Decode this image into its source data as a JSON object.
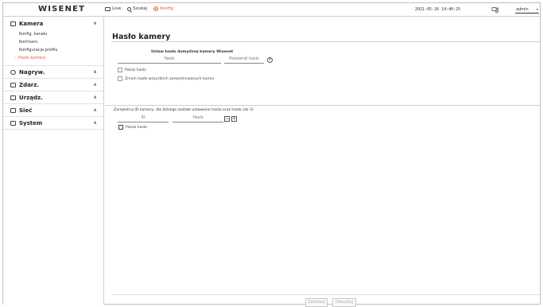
{
  "brand": {
    "logo": "WISENET"
  },
  "topnav": {
    "live": "Live",
    "search": "Szukaj",
    "config": "Konfig"
  },
  "status": {
    "datetime": "2021-05-26 14:40:25",
    "user": "admin"
  },
  "sidebar": {
    "groups": [
      {
        "label": "Kamera",
        "icon": "camera-icon",
        "expanded": true,
        "items": [
          {
            "label": "Konfig. kanału"
          },
          {
            "label": "Konf.kam."
          },
          {
            "label": "Konfiguracja profilu"
          },
          {
            "label": "Hasło kamery",
            "active": true
          }
        ]
      },
      {
        "label": "Nagryw.",
        "icon": "record-icon"
      },
      {
        "label": "Zdarz.",
        "icon": "event-icon"
      },
      {
        "label": "Urządz.",
        "icon": "device-icon"
      },
      {
        "label": "Sieć",
        "icon": "network-icon"
      },
      {
        "label": "System",
        "icon": "system-icon"
      }
    ]
  },
  "main": {
    "title": "Hasło kamery",
    "section1": {
      "subtitle": "Ustaw hasło domyślnej kamery Wisenet",
      "password_placeholder": "Hasło",
      "confirm_placeholder": "Potwierdź hasło",
      "show_password": "Pokaż hasło",
      "change_all": "Zmień hasło wszystkich zarejestrowanych kamer"
    },
    "section2": {
      "subtitle": "Zarejestruj ID kamery, dla którego zostało ustawione hasło oraz hasło (do 3)",
      "id_placeholder": "ID",
      "password_placeholder": "Hasło",
      "minus": "−",
      "plus": "+",
      "show_password": "Pokaż hasło"
    },
    "footer": {
      "apply": "Zastosuj",
      "cancel": "Odrzykuj"
    }
  },
  "colors": {
    "accent": "#e8583e"
  }
}
